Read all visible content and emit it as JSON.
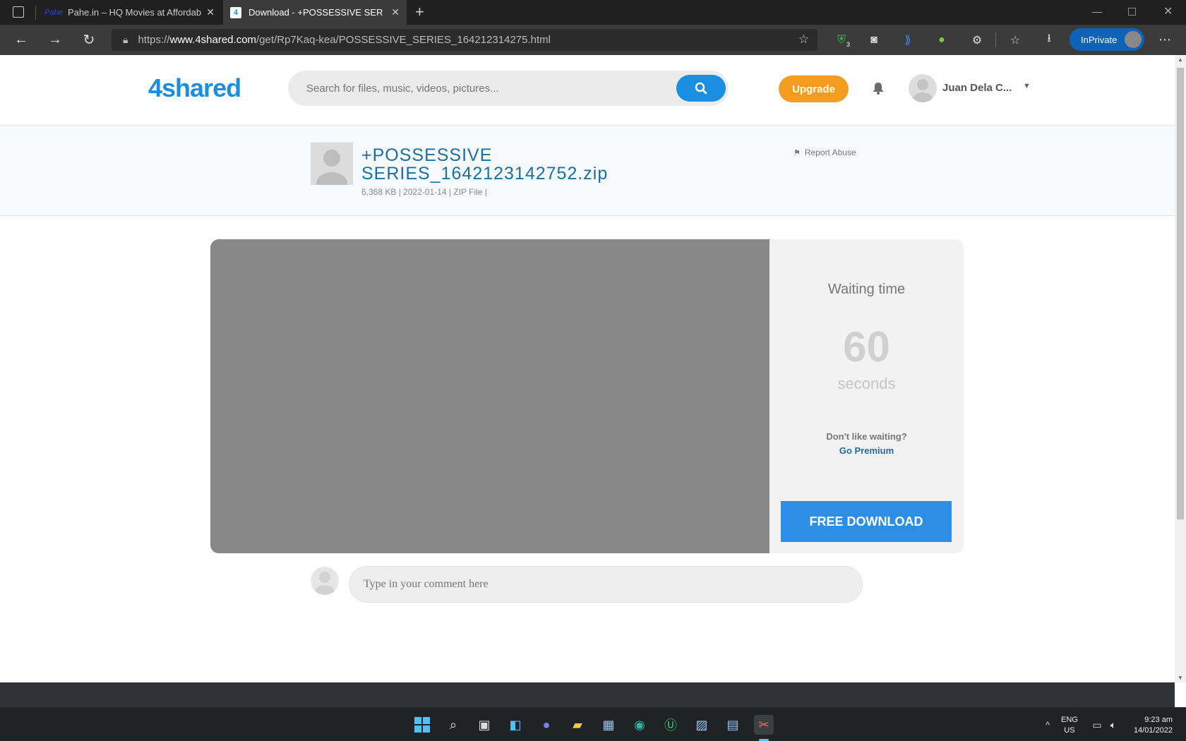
{
  "browser": {
    "tabs": [
      {
        "title": "Pahe.in – HQ Movies at Affordab",
        "favicon": "Pahe",
        "active": false
      },
      {
        "title": "Download - +POSSESSIVE SERIES",
        "favicon": "4",
        "active": true
      }
    ],
    "url_prefix": "https://",
    "url_domain": "www.4shared.com",
    "url_path": "/get/Rp7Kaq-kea/POSSESSIVE_SERIES_164212314275.html",
    "extension_badge": "3",
    "inprivate_label": "InPrivate"
  },
  "site": {
    "logo": "4shared",
    "search_placeholder": "Search for files, music, videos, pictures...",
    "upgrade_label": "Upgrade",
    "username": "Juan Dela C...",
    "brand_color": "#1a8ee0",
    "upgrade_color": "#f39c1f"
  },
  "file": {
    "title": "+POSSESSIVE SERIES_1642123142752.zip",
    "size": "6,368 KB",
    "date": "2022-01-14",
    "type": "ZIP File",
    "report_label": "Report Abuse"
  },
  "download": {
    "waiting_title": "Waiting time",
    "seconds_value": "60",
    "seconds_unit": "seconds",
    "dont_like": "Don't like waiting?",
    "go_premium": "Go Premium",
    "button_label": "FREE DOWNLOAD"
  },
  "comment": {
    "placeholder": "Type in your comment here"
  },
  "taskbar": {
    "lang_top": "ENG",
    "lang_bottom": "US",
    "time": "9:23 am",
    "date": "14/01/2022"
  }
}
